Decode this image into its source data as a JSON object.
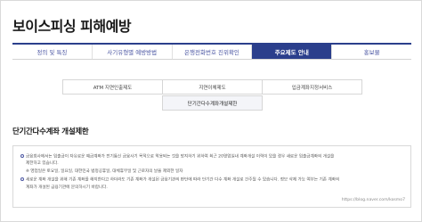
{
  "page_title": "보이스피싱 피해예방",
  "tabs": [
    {
      "label": "정의 및 특징",
      "active": false
    },
    {
      "label": "사기유형별 예방방법",
      "active": false
    },
    {
      "label": "은행전화번호 진위확인",
      "active": false
    },
    {
      "label": "주요제도 안내",
      "active": true
    },
    {
      "label": "홍보물",
      "active": false
    }
  ],
  "sub_tabs": {
    "row1": [
      "ATM 지연인출제도",
      "지연이체제도",
      "입금계좌지정서비스"
    ],
    "row2": [
      "단기간다수계좌개설제한"
    ]
  },
  "section": {
    "heading": "단기간다수계좌 개설제한",
    "lines": [
      "금융회사에서는 입출금이 자유로운 예금계좌가 전기통신 금융사기 목적으로 악용되는 것을 방지하기 위하여 최근 20영업일내 계좌개설 이력이 있을 경우 새로운 입출금계좌의 개설을",
      "제한하고 있습니다.",
      "※ 영업일은 토요일, 일요일, 대한민국 법정공휴일, 대체휴무일 및 근로자의 날을 제외한 일자",
      "새로운 계좌 개설을 위해 기존 계좌를 해지한다고 하더라도 기존 계좌가 개설된 금융기관의 판단에 따라 단기간 다수 계좌 개설로 간주될 수 있습니다. 정보 삭제 가능 여부는 기존 계좌의",
      "계좌가 개설된 금융기관에 문의하시기 바랍니다."
    ]
  },
  "watermark": "https://blog.naver.com/kosmo7"
}
